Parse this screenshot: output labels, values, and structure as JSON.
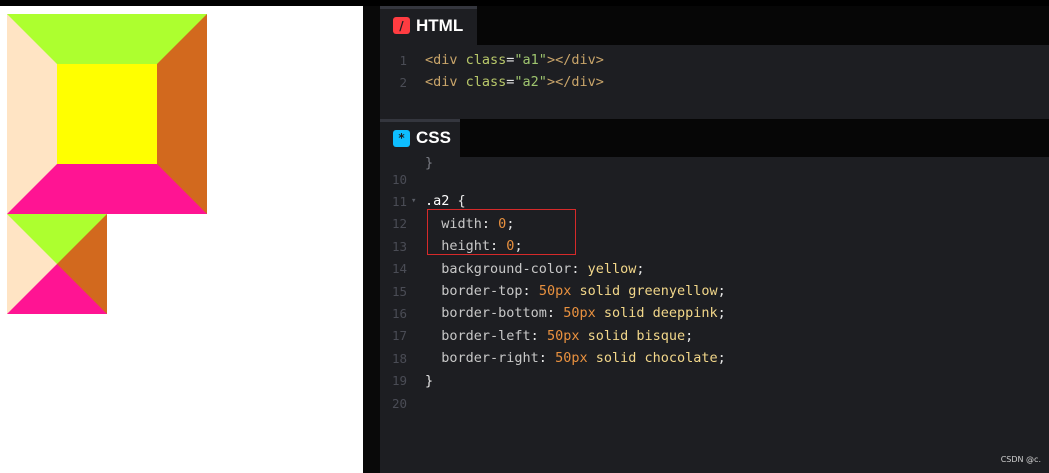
{
  "colors": {
    "greenyellow": "#adff2f",
    "deeppink": "#ff1493",
    "bisque": "#ffe4c4",
    "chocolate": "#d2691e",
    "yellow": "#ffff00"
  },
  "panes": {
    "html": {
      "title": "HTML",
      "icon_glyph": "/",
      "icon_color": "#ff3c41"
    },
    "css": {
      "title": "CSS",
      "icon_glyph": "*",
      "icon_color": "#0ebeff"
    }
  },
  "html_code": [
    {
      "ln": "1",
      "tokens": [
        [
          "t-tag",
          "<div "
        ],
        [
          "t-attr",
          "class"
        ],
        [
          "t-punct",
          "="
        ],
        [
          "t-str",
          "\"a1\""
        ],
        [
          "t-tag",
          "></div>"
        ]
      ]
    },
    {
      "ln": "2",
      "tokens": [
        [
          "t-tag",
          "<div "
        ],
        [
          "t-attr",
          "class"
        ],
        [
          "t-punct",
          "="
        ],
        [
          "t-str",
          "\"a2\""
        ],
        [
          "t-tag",
          "></div>"
        ]
      ]
    }
  ],
  "css_code": [
    {
      "ln": "10",
      "fold": "",
      "tokens": []
    },
    {
      "ln": "11",
      "fold": "▾",
      "tokens": [
        [
          "t-sel",
          ".a2 "
        ],
        [
          "t-punct",
          "{"
        ]
      ]
    },
    {
      "ln": "12",
      "fold": "",
      "tokens": [
        [
          "t-prop",
          "  width"
        ],
        [
          "t-punct",
          ": "
        ],
        [
          "t-num",
          "0"
        ],
        [
          "t-punct",
          ";"
        ]
      ]
    },
    {
      "ln": "13",
      "fold": "",
      "tokens": [
        [
          "t-prop",
          "  height"
        ],
        [
          "t-punct",
          ": "
        ],
        [
          "t-num",
          "0"
        ],
        [
          "t-punct",
          ";"
        ]
      ]
    },
    {
      "ln": "14",
      "fold": "",
      "tokens": [
        [
          "t-prop",
          "  background-color"
        ],
        [
          "t-punct",
          ": "
        ],
        [
          "t-val",
          "yellow"
        ],
        [
          "t-punct",
          ";"
        ]
      ]
    },
    {
      "ln": "15",
      "fold": "",
      "tokens": [
        [
          "t-prop",
          "  border-top"
        ],
        [
          "t-punct",
          ": "
        ],
        [
          "t-num",
          "50px"
        ],
        [
          "t-val",
          " solid greenyellow"
        ],
        [
          "t-punct",
          ";"
        ]
      ]
    },
    {
      "ln": "16",
      "fold": "",
      "tokens": [
        [
          "t-prop",
          "  border-bottom"
        ],
        [
          "t-punct",
          ": "
        ],
        [
          "t-num",
          "50px"
        ],
        [
          "t-val",
          " solid deeppink"
        ],
        [
          "t-punct",
          ";"
        ]
      ]
    },
    {
      "ln": "17",
      "fold": "",
      "tokens": [
        [
          "t-prop",
          "  border-left"
        ],
        [
          "t-punct",
          ": "
        ],
        [
          "t-num",
          "50px"
        ],
        [
          "t-val",
          " solid bisque"
        ],
        [
          "t-punct",
          ";"
        ]
      ]
    },
    {
      "ln": "18",
      "fold": "",
      "tokens": [
        [
          "t-prop",
          "  border-right"
        ],
        [
          "t-punct",
          ": "
        ],
        [
          "t-num",
          "50px"
        ],
        [
          "t-val",
          " solid chocolate"
        ],
        [
          "t-punct",
          ";"
        ]
      ]
    },
    {
      "ln": "19",
      "fold": "",
      "tokens": [
        [
          "t-punct",
          "}"
        ]
      ]
    },
    {
      "ln": "20",
      "fold": "",
      "tokens": []
    }
  ],
  "watermark": "CSDN @c."
}
